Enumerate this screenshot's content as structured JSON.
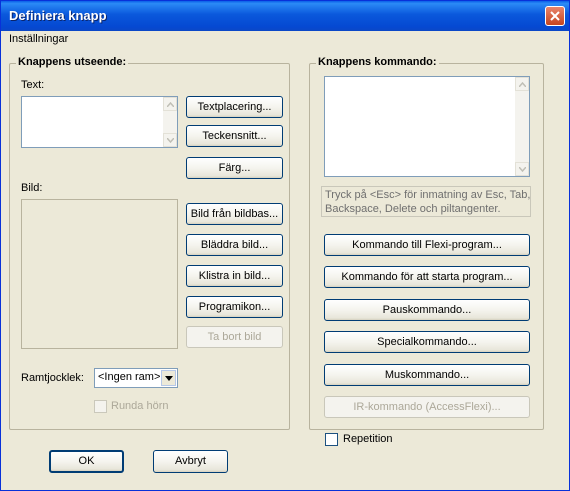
{
  "window": {
    "title": "Definiera knapp"
  },
  "menu": {
    "items": [
      "Inställningar"
    ]
  },
  "appearance": {
    "heading": "Knappens utseende:",
    "text_label": "Text:",
    "image_label": "Bild:",
    "buttons": {
      "text_placement": "Textplacering...",
      "font": "Teckensnitt...",
      "color": "Färg...",
      "image_from_db": "Bild från bildbas...",
      "browse_image": "Bläddra bild...",
      "paste_image": "Klistra in bild...",
      "program_icon": "Programikon...",
      "remove_image": "Ta bort bild"
    },
    "frame_label": "Ramtjocklek:",
    "frame_value": "<Ingen ram>",
    "round_corners": "Runda hörn"
  },
  "command": {
    "heading": "Knappens kommando:",
    "hint": "Tryck på <Esc> för inmatning av Esc, Tab, Backspace, Delete och piltangenter.",
    "buttons": {
      "flexi": "Kommando till Flexi-program...",
      "start_program": "Kommando för att starta program...",
      "pause": "Pauskommando...",
      "special": "Specialkommando...",
      "mouse": "Muskommando...",
      "ir": "IR-kommando (AccessFlexi)..."
    },
    "repetition": "Repetition"
  },
  "footer": {
    "ok": "OK",
    "cancel": "Avbryt"
  }
}
